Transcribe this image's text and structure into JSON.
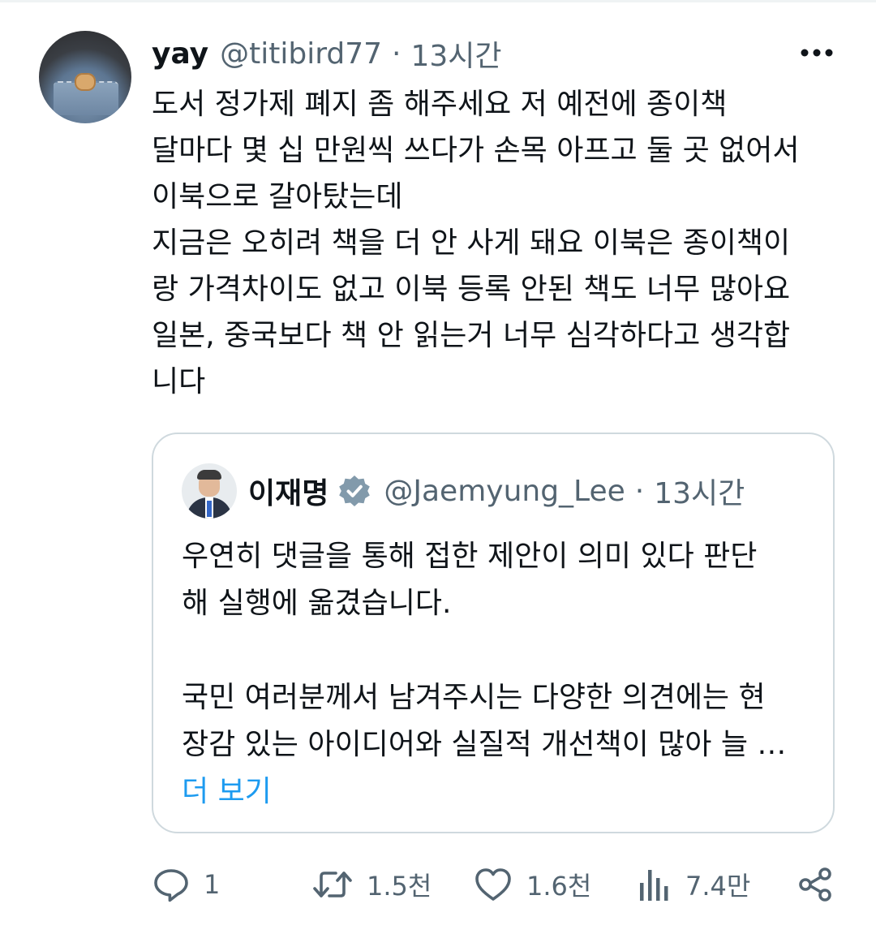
{
  "tweet": {
    "author_name": "yay",
    "author_handle": "@titibird77",
    "separator": "·",
    "time": "13시간",
    "lines": [
      "도서 정가제 폐지 좀 해주세요 저 예전에 종이책",
      "달마다 몇 십 만원씩 쓰다가 손목 아프고 둘 곳 없어서",
      "이북으로 갈아탔는데",
      "지금은 오히려 책을 더 안 사게 돼요 이북은 종이책이",
      "랑 가격차이도 없고 이북 등록 안된 책도 너무 많아요",
      "일본, 중국보다 책 안 읽는거 너무 심각하다고 생각합",
      "니다"
    ]
  },
  "quoted": {
    "author_name": "이재명",
    "author_handle": "@Jaemyung_Lee",
    "separator": "·",
    "time": "13시간",
    "verified_icon": "verified-badge-icon",
    "lines": [
      "우연히 댓글을 통해 접한 제안이 의미 있다 판단",
      "해 실행에 옮겼습니다.",
      "",
      "국민 여러분께서 남겨주시는 다양한 의견에는 현",
      "장감 있는 아이디어와 실질적 개선책이 많아 늘 …"
    ],
    "show_more": "더 보기"
  },
  "actions": {
    "replies": "1",
    "retweets": "1.5천",
    "likes": "1.6천",
    "views": "7.4만"
  },
  "colors": {
    "text": "#0f1419",
    "secondary": "#536471",
    "link": "#1d9bf0",
    "border": "#cfd9de"
  }
}
